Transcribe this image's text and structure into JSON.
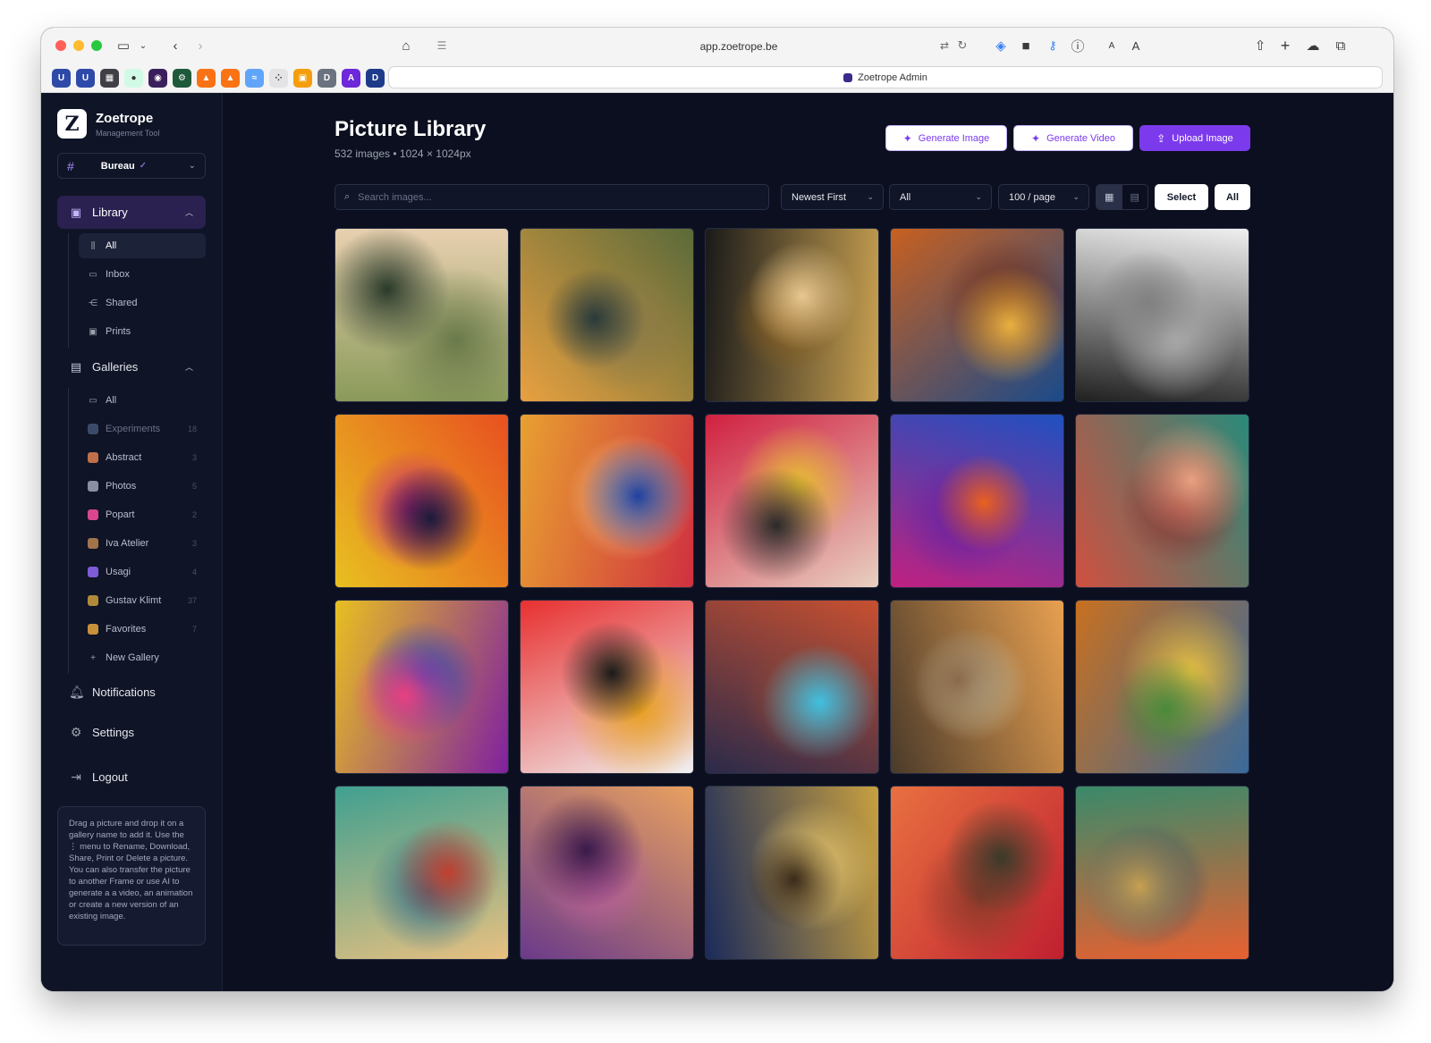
{
  "browser": {
    "url": "app.zoetrope.be",
    "active_tab_title": "Zoetrope Admin",
    "favicons": [
      {
        "label": "U",
        "color": "#2e4aa8"
      },
      {
        "label": "U",
        "color": "#2e4aa8"
      },
      {
        "label": "▦",
        "color": "#3f3f46"
      },
      {
        "label": "●",
        "color": "#d1fae5"
      },
      {
        "label": "◉",
        "color": "#3b1f5c"
      },
      {
        "label": "⚙",
        "color": "#1e5a3a"
      },
      {
        "label": "▲",
        "color": "#f97316"
      },
      {
        "label": "▲",
        "color": "#f97316"
      },
      {
        "label": "≈",
        "color": "#60a5fa"
      },
      {
        "label": "⁘",
        "color": "#e4e4e7"
      },
      {
        "label": "▣",
        "color": "#f59e0b"
      },
      {
        "label": "D",
        "color": "#6b7280"
      },
      {
        "label": "A",
        "color": "#6d28d9"
      },
      {
        "label": "D",
        "color": "#1e3a8a"
      }
    ]
  },
  "brand": {
    "name": "Zoetrope",
    "subtitle": "Management Tool",
    "logo": "Z"
  },
  "workspace": {
    "name": "Bureau"
  },
  "sidebar": {
    "library": {
      "label": "Library",
      "items": [
        {
          "label": "All",
          "icon": "library-icon"
        },
        {
          "label": "Inbox",
          "icon": "inbox-icon"
        },
        {
          "label": "Shared",
          "icon": "share-icon"
        },
        {
          "label": "Prints",
          "icon": "image-icon"
        }
      ]
    },
    "galleries": {
      "label": "Galleries",
      "all_label": "All",
      "items": [
        {
          "label": "Experiments",
          "count": "18",
          "color": "#3a4a6a"
        },
        {
          "label": "Abstract",
          "count": "3",
          "color": "#c0704a"
        },
        {
          "label": "Photos",
          "count": "5",
          "color": "#8a8fa3"
        },
        {
          "label": "Popart",
          "count": "2",
          "color": "#d9468f"
        },
        {
          "label": "Iva Atelier",
          "count": "3",
          "color": "#a3744a"
        },
        {
          "label": "Usagi",
          "count": "4",
          "color": "#7c5cd9"
        },
        {
          "label": "Gustav Klimt",
          "count": "37",
          "color": "#b08a3a"
        },
        {
          "label": "Favorites",
          "count": "7",
          "color": "#c8903a"
        }
      ],
      "new_label": "New Gallery"
    },
    "notifications_label": "Notifications",
    "settings_label": "Settings",
    "logout_label": "Logout",
    "tip": "Drag a picture and drop it on a gallery name to add it. Use the ⋮ menu to Rename, Download, Share, Print or Delete a picture. You can also transfer the picture to another Frame or use AI to generate a a video, an animation or create a new version of an existing image."
  },
  "main": {
    "title": "Picture Library",
    "subtitle": "532 images • 1024 × 1024px",
    "buttons": {
      "generate_image": "Generate Image",
      "generate_video": "Generate Video",
      "upload_image": "Upload Image"
    },
    "search_placeholder": "Search images...",
    "sort": "Newest First",
    "filter": "All",
    "per_page": "100 / page",
    "select_label": "Select",
    "all_label": "All"
  },
  "images": [
    {
      "name": "woman-with-apple",
      "colors": [
        "#8a9a5a",
        "#e8d0b0",
        "#2a3a2a",
        "#6a7a4a"
      ]
    },
    {
      "name": "mountain-sunset",
      "colors": [
        "#e8a040",
        "#5a6a3a",
        "#2a3a3a",
        "#8a7a4a"
      ]
    },
    {
      "name": "golden-goddess",
      "colors": [
        "#1a1a1a",
        "#c8a050",
        "#e8c890",
        "#8a6020"
      ]
    },
    {
      "name": "mandala",
      "colors": [
        "#c86020",
        "#1a4a8a",
        "#e8b040",
        "#6a2a1a"
      ]
    },
    {
      "name": "bw-portrait",
      "colors": [
        "#f0f0f0",
        "#202020",
        "#808080",
        "#b0b0b0"
      ]
    },
    {
      "name": "psychedelic-figure",
      "colors": [
        "#e85020",
        "#e8c020",
        "#1a1a3a",
        "#c02080"
      ]
    },
    {
      "name": "abstract-swirls",
      "colors": [
        "#d03040",
        "#e8a030",
        "#2040a0",
        "#f0d0a0"
      ]
    },
    {
      "name": "paint-explosion",
      "colors": [
        "#e8d0c0",
        "#d02040",
        "#2a2a2a",
        "#e8c030"
      ]
    },
    {
      "name": "phoenix-bird",
      "colors": [
        "#c02080",
        "#2050c0",
        "#e86020",
        "#6a20a0"
      ]
    },
    {
      "name": "red-bedroom",
      "colors": [
        "#d05040",
        "#2a8a7a",
        "#e8a080",
        "#8a2a2a"
      ]
    },
    {
      "name": "popart-man",
      "colors": [
        "#e8c020",
        "#8020a0",
        "#e84080",
        "#2040c0"
      ]
    },
    {
      "name": "popart-woman",
      "colors": [
        "#e83030",
        "#f0f0f0",
        "#1a1a1a",
        "#e8a020"
      ]
    },
    {
      "name": "spaceship",
      "colors": [
        "#c85030",
        "#2a2a4a",
        "#40c0e0",
        "#8a4a3a"
      ]
    },
    {
      "name": "desert-castle",
      "colors": [
        "#e8a050",
        "#4a3a2a",
        "#8a6a4a",
        "#c8c0a0"
      ]
    },
    {
      "name": "painted-tank",
      "colors": [
        "#3a6a9a",
        "#c87020",
        "#4a8a3a",
        "#e8c040"
      ]
    },
    {
      "name": "balloon-circus",
      "colors": [
        "#e8c080",
        "#40a090",
        "#c04030",
        "#2a6a8a"
      ]
    },
    {
      "name": "cathedral-ceiling",
      "colors": [
        "#6a3a8a",
        "#e8a060",
        "#3a1a4a",
        "#c060a0"
      ]
    },
    {
      "name": "singer-portrait",
      "colors": [
        "#1a2a5a",
        "#c8a040",
        "#3a2a1a",
        "#e8c870"
      ]
    },
    {
      "name": "flower-tank",
      "colors": [
        "#e87040",
        "#c02030",
        "#3a3a2a",
        "#8a3a2a"
      ]
    },
    {
      "name": "impressionist-portrait",
      "colors": [
        "#3a8a6a",
        "#e86030",
        "#c8a050",
        "#2a4a6a"
      ]
    }
  ]
}
